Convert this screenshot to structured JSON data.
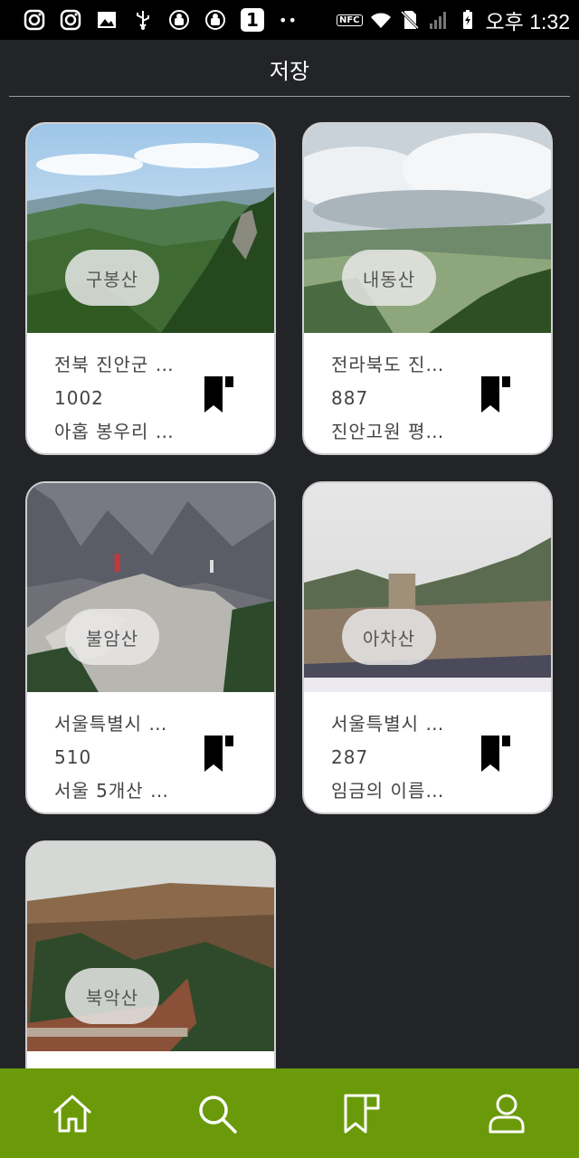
{
  "status_bar": {
    "time": "오후 1:32",
    "badge": "1",
    "dots": "••",
    "nfc": "NFC"
  },
  "header": {
    "title": "저장"
  },
  "cards": [
    {
      "name": "구봉산",
      "location": "전북 진안군 …",
      "height": "1002",
      "description": "아홉 봉우리 …"
    },
    {
      "name": "내동산",
      "location": "전라북도 진…",
      "height": "887",
      "description": "진안고원 평…"
    },
    {
      "name": "불암산",
      "location": "서울특별시 …",
      "height": "510",
      "description": "서울 5개산 …"
    },
    {
      "name": "아차산",
      "location": "서울특별시 …",
      "height": "287",
      "description": "임금의 이름…"
    },
    {
      "name": "북악산",
      "location": "",
      "height": "",
      "description": ""
    }
  ],
  "nav": {
    "items": [
      "home-icon",
      "search-icon",
      "bookmark-icon",
      "profile-icon"
    ]
  },
  "colors": {
    "background": "#232428",
    "nav": "#6a9a0a",
    "card": "#ffffff"
  }
}
